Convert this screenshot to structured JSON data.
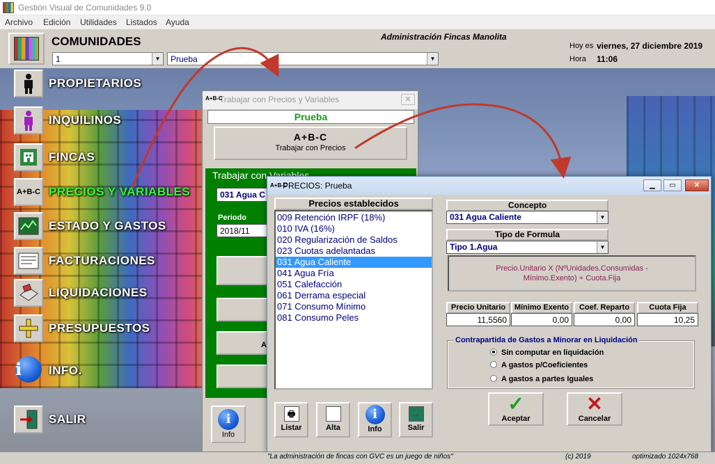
{
  "window": {
    "title": "Gestión Visual de Comunidades 9.0"
  },
  "menu": [
    "Archivo",
    "Edición",
    "Utilidades",
    "Listados",
    "Ayuda"
  ],
  "header": {
    "section_title": "COMUNIDADES",
    "community_number": "1",
    "community_name": "Prueba",
    "admin_name": "Administración Fincas Manolita",
    "hoy_label": "Hoy es",
    "date": "viernes, 27 diciembre 2019",
    "hora_label": "Hora",
    "time": "11:06"
  },
  "sidebar": {
    "items": [
      {
        "label": "PROPIETARIOS",
        "icon": "person-icon"
      },
      {
        "label": "INQUILINOS",
        "icon": "tenant-icon"
      },
      {
        "label": "FINCAS",
        "icon": "building-icon"
      },
      {
        "label": "PRECIOS Y VARIABLES",
        "icon": "abc-icon",
        "active": true
      },
      {
        "label": "ESTADO  Y  GASTOS",
        "icon": "chart-icon"
      },
      {
        "label": "FACTURACIONES",
        "icon": "invoice-icon"
      },
      {
        "label": "LIQUIDACIONES",
        "icon": "stamp-icon"
      },
      {
        "label": "PRESUPUESTOS",
        "icon": "ruler-icon"
      },
      {
        "label": "INFO.",
        "icon": "info-icon"
      },
      {
        "label": "SALIR",
        "icon": "exit-door-icon"
      }
    ]
  },
  "back_window": {
    "title": "Trabajar con Precios y Variables",
    "community": "Prueba",
    "abc": "A+B-C",
    "precios_button": "Trabajar con Precios",
    "group_title": "Trabajar con Variables",
    "variable_selected": "031 Agua C",
    "periodo_label": "Periodo",
    "periodo_value": "2018/11",
    "partial_button": "A",
    "info_button": "Info"
  },
  "front_window": {
    "title": "PRECIOS:  Prueba",
    "list_header": "Precios establecidos",
    "items": [
      "009 Retención IRPF (18%)",
      "010 IVA (16%)",
      "020 Regularización de Saldos",
      "023 Cuotas adelantadas",
      "031 Agua Caliente",
      "041 Agua Fría",
      "051 Calefacción",
      "061 Derrama especial",
      "071 Consumo Mínimo",
      "081 Consumo Peles"
    ],
    "selected_index": 4,
    "concepto_label": "Concepto",
    "concepto_value": "031 Agua Caliente",
    "tipo_label": "Tipo de Formula",
    "tipo_value": "Tipo 1.Agua",
    "formula_line1": "Precio.Unitario  X  (NºUnidades.Consumidas  -",
    "formula_line2": "Mínimo.Exento)  +  Cuota.Fija",
    "fields": {
      "precio_unitario_label": "Precio Unitario",
      "precio_unitario": "11,5560",
      "minimo_exento_label": "Mínimo Exento",
      "minimo_exento": "0,00",
      "coef_reparto_label": "Coef. Reparto",
      "coef_reparto": "0,00",
      "cuota_fija_label": "Cuota Fija",
      "cuota_fija": "10,25"
    },
    "group_title": "Contrapartida de Gastos a Minorar en Liquidación",
    "radio_options": [
      "Sin computar en liquidación",
      "A gastos p/Coeficientes",
      "A gastos a partes Iguales"
    ],
    "radio_selected": 0,
    "buttons": {
      "aceptar": "Aceptar",
      "cancelar": "Cancelar",
      "listar": "Listar",
      "alta": "Alta",
      "info": "Info",
      "salir": "Salir"
    }
  },
  "footer": {
    "tagline": "\"La administración de fincas con GVC es un juego de niños\"",
    "copyright": "(c) 2019",
    "optimized": "optimizado 1024x768"
  },
  "colors": {
    "active_menu": "#33ff33",
    "selection": "#3399ff",
    "annotation_arrows": "#c0392b",
    "group_green": "#008000"
  }
}
